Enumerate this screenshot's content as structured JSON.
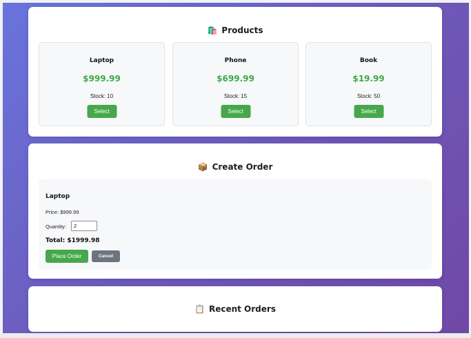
{
  "products_section": {
    "icon": "shopping-bags-icon",
    "title": "Products",
    "items": [
      {
        "name": "Laptop",
        "price": "$999.99",
        "stock": "Stock: 10",
        "button": "Select"
      },
      {
        "name": "Phone",
        "price": "$699.99",
        "stock": "Stock: 15",
        "button": "Select"
      },
      {
        "name": "Book",
        "price": "$19.99",
        "stock": "Stock: 50",
        "button": "Select"
      }
    ]
  },
  "create_order": {
    "icon": "package-icon",
    "title": "Create Order",
    "product_name": "Laptop",
    "price_text": "Price: $999.99",
    "quantity_label": "Quantity:",
    "quantity_value": "2",
    "total_text": "Total: $1999.98",
    "place_order_label": "Place Order",
    "cancel_label": "Cancel"
  },
  "recent_orders": {
    "icon": "clipboard-icon",
    "title": "Recent Orders"
  },
  "colors": {
    "accent_green": "#46a84a",
    "price_green": "#3ea846",
    "cancel_gray": "#6c757d",
    "background_gradient_start": "#6874dc",
    "background_gradient_end": "#7048a6"
  }
}
